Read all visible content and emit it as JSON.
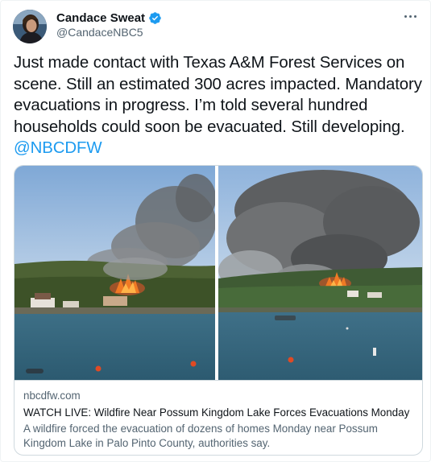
{
  "author": {
    "display_name": "Candace Sweat",
    "handle": "@CandaceNBC5",
    "verified": true,
    "avatar_icon": "profile-photo"
  },
  "more_icon": "more-horizontal-icon",
  "tweet": {
    "text_before_mention": "Just made contact with Texas A&M Forest Services on scene. Still an estimated 300 acres impacted. Mandatory evacuations in progress. I’m told several hundred households could soon be evacuated. Still developing. ",
    "mention": "@NBCDFW"
  },
  "card": {
    "domain": "nbcdfw.com",
    "title": "WATCH LIVE: Wildfire Near Possum Kingdom Lake Forces Evacuations Monday",
    "description": "A wildfire forced the evacuation of dozens of homes Monday near Possum Kingdom Lake in Palo Pinto County, authorities say."
  },
  "colors": {
    "accent": "#1d9bf0",
    "text_primary": "#0f1419",
    "text_secondary": "#536471",
    "border": "#cfd9de"
  }
}
